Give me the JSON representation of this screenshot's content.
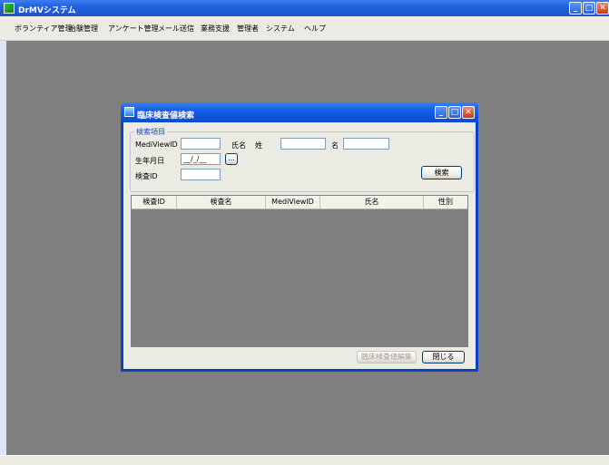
{
  "app": {
    "title": "DrMVシステム",
    "window_buttons": {
      "minimize": "_",
      "maximize": "□",
      "close": "✕"
    }
  },
  "menu": {
    "items": [
      "ボランティア管理",
      "治験管理",
      "アンケート管理",
      "メール送信",
      "業務支援",
      "管理者",
      "システム",
      "ヘルプ"
    ]
  },
  "dialog": {
    "title": "臨床検査値検索",
    "group_label": "検索項目",
    "labels": {
      "mediviewid": "MediViewID",
      "name": "氏名",
      "last": "姓",
      "first": "名",
      "birthdate": "生年月日",
      "examid": "検査ID"
    },
    "fields": {
      "mediviewid": "",
      "last_name": "",
      "first_name": "",
      "birthdate": "__/_/__",
      "examid": ""
    },
    "buttons": {
      "calendar": "...",
      "search": "検索",
      "edit": "臨床検査値編集",
      "close": "閉じる"
    },
    "columns": [
      "検査ID",
      "検査名",
      "MediViewID",
      "氏名",
      "性別"
    ]
  }
}
